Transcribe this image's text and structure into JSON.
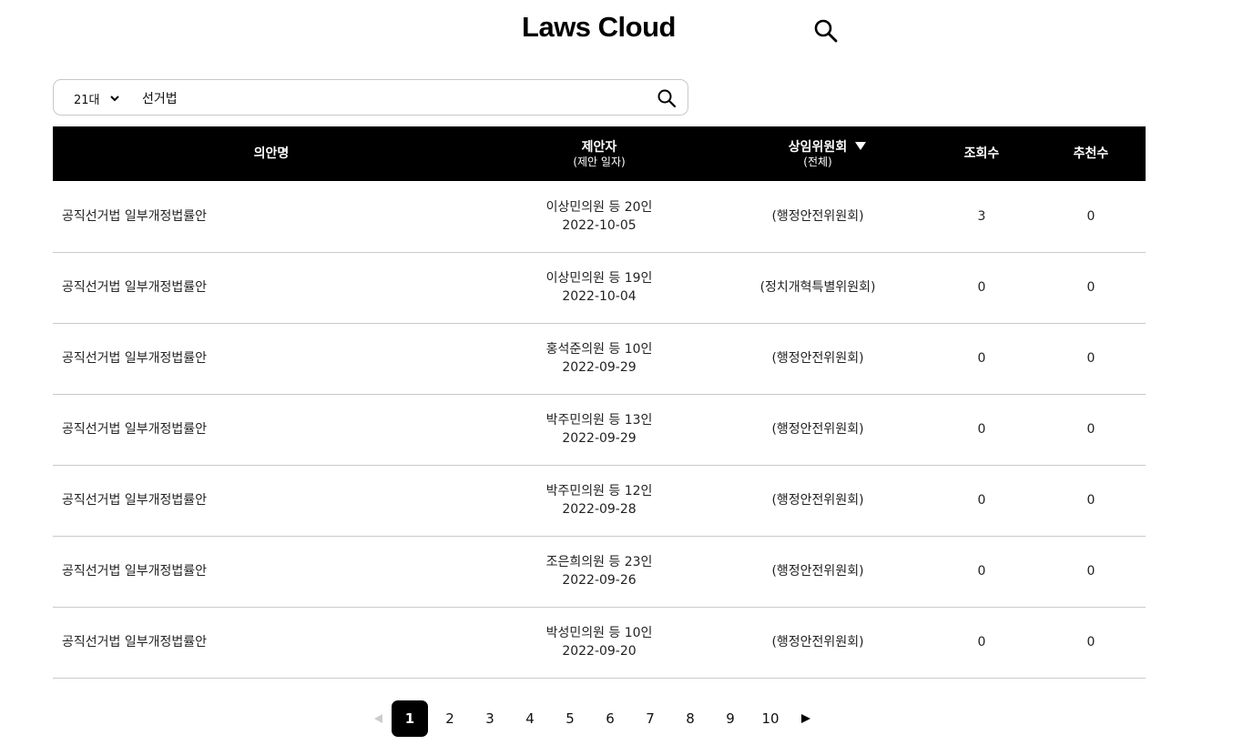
{
  "app": {
    "title": "Laws Cloud"
  },
  "search": {
    "session": "21대",
    "query": "선거법"
  },
  "table": {
    "headers": {
      "title": "의안명",
      "proposer": "제안자",
      "proposer_sub": "(제안 일자)",
      "committee": "상임위원회",
      "committee_sub": "(전체)",
      "views": "조회수",
      "likes": "추천수"
    },
    "rows": [
      {
        "title": "공직선거법 일부개정법률안",
        "proposer": "이상민의원 등 20인",
        "date": "2022-10-05",
        "committee": "(행정안전위원회)",
        "views": "3",
        "likes": "0"
      },
      {
        "title": "공직선거법 일부개정법률안",
        "proposer": "이상민의원 등 19인",
        "date": "2022-10-04",
        "committee": "(정치개혁특별위원회)",
        "views": "0",
        "likes": "0"
      },
      {
        "title": "공직선거법 일부개정법률안",
        "proposer": "홍석준의원 등 10인",
        "date": "2022-09-29",
        "committee": "(행정안전위원회)",
        "views": "0",
        "likes": "0"
      },
      {
        "title": "공직선거법 일부개정법률안",
        "proposer": "박주민의원 등 13인",
        "date": "2022-09-29",
        "committee": "(행정안전위원회)",
        "views": "0",
        "likes": "0"
      },
      {
        "title": "공직선거법 일부개정법률안",
        "proposer": "박주민의원 등 12인",
        "date": "2022-09-28",
        "committee": "(행정안전위원회)",
        "views": "0",
        "likes": "0"
      },
      {
        "title": "공직선거법 일부개정법률안",
        "proposer": "조은희의원 등 23인",
        "date": "2022-09-26",
        "committee": "(행정안전위원회)",
        "views": "0",
        "likes": "0"
      },
      {
        "title": "공직선거법 일부개정법률안",
        "proposer": "박성민의원 등 10인",
        "date": "2022-09-20",
        "committee": "(행정안전위원회)",
        "views": "0",
        "likes": "0"
      }
    ]
  },
  "pagination": {
    "pages": [
      "1",
      "2",
      "3",
      "4",
      "5",
      "6",
      "7",
      "8",
      "9",
      "10"
    ],
    "current": "1"
  },
  "icons": {
    "header_search": "search-icon",
    "bar_search": "search-icon",
    "select": "chevron-down-icon",
    "sort": "triangle-down-icon",
    "prev": "triangle-left-icon",
    "next": "triangle-right-icon"
  },
  "colors": {
    "header_bg": "#000000",
    "active_page": "#000000",
    "disabled_arrow": "#cccccc",
    "row_border": "#c9c9c9"
  }
}
